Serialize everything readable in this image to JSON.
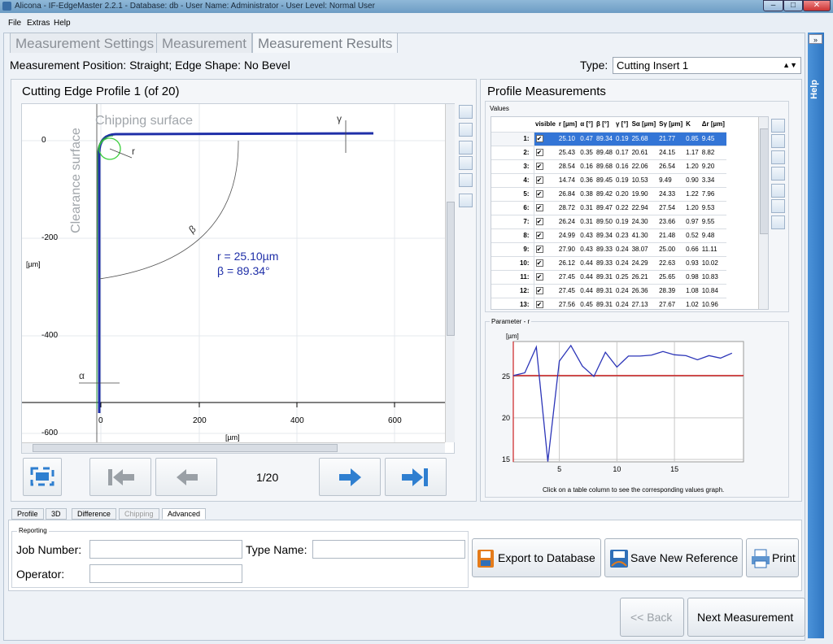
{
  "window": {
    "title": "Alicona - IF-EdgeMaster 2.2.1 - Database: db - User Name: Administrator - User Level: Normal User",
    "controls": [
      "–",
      "□",
      "✕"
    ]
  },
  "menu": [
    "File",
    "Extras",
    "Help"
  ],
  "tabs": [
    "Measurement Settings",
    "Measurement",
    "Measurement Results"
  ],
  "help_label": "Help",
  "help_chevron": "»",
  "position_text": "Measurement Position: Straight; Edge Shape: No Bevel",
  "type": {
    "label": "Type:",
    "value": "Cutting Insert 1"
  },
  "profile_panel": {
    "title": "Cutting Edge Profile 1 (of 20)",
    "chipping_surface": "Chipping surface",
    "clearance_surface": "Clearance surface",
    "result_r": "r = 25.10µm",
    "result_beta": "β = 89.34°",
    "label_beta": "β",
    "label_r": "r",
    "label_gamma": "γ",
    "label_alpha": "α",
    "y_unit": "[µm]",
    "x_unit": "[µm]",
    "y_ticks": [
      "0",
      "-200",
      "-400",
      "-600"
    ],
    "x_ticks": [
      "0",
      "200",
      "400",
      "600"
    ],
    "counter": "1/20"
  },
  "measurements_panel": {
    "title": "Profile Measurements",
    "values_label": "Values",
    "columns": [
      "",
      "visible",
      "r [µm]",
      "α [°]",
      "β [°]",
      "γ [°]",
      "Sα [µm]",
      "Sγ [µm]",
      "K",
      "Δr [µm]"
    ],
    "rows": [
      [
        "1:",
        "25.10",
        "0.47",
        "89.34",
        "0.19",
        "25.68",
        "21.77",
        "0.85",
        "9.45"
      ],
      [
        "2:",
        "25.43",
        "0.35",
        "89.48",
        "0.17",
        "20.61",
        "24.15",
        "1.17",
        "8.82"
      ],
      [
        "3:",
        "28.54",
        "0.16",
        "89.68",
        "0.16",
        "22.06",
        "26.54",
        "1.20",
        "9.20"
      ],
      [
        "4:",
        "14.74",
        "0.36",
        "89.45",
        "0.19",
        "10.53",
        "9.49",
        "0.90",
        "3.34"
      ],
      [
        "5:",
        "26.84",
        "0.38",
        "89.42",
        "0.20",
        "19.90",
        "24.33",
        "1.22",
        "7.96"
      ],
      [
        "6:",
        "28.72",
        "0.31",
        "89.47",
        "0.22",
        "22.94",
        "27.54",
        "1.20",
        "9.53"
      ],
      [
        "7:",
        "26.24",
        "0.31",
        "89.50",
        "0.19",
        "24.30",
        "23.66",
        "0.97",
        "9.55"
      ],
      [
        "8:",
        "24.99",
        "0.43",
        "89.34",
        "0.23",
        "41.30",
        "21.48",
        "0.52",
        "9.48"
      ],
      [
        "9:",
        "27.90",
        "0.43",
        "89.33",
        "0.24",
        "38.07",
        "25.00",
        "0.66",
        "11.11"
      ],
      [
        "10:",
        "26.12",
        "0.44",
        "89.33",
        "0.24",
        "24.29",
        "22.63",
        "0.93",
        "10.02"
      ],
      [
        "11:",
        "27.45",
        "0.44",
        "89.31",
        "0.25",
        "26.21",
        "25.65",
        "0.98",
        "10.83"
      ],
      [
        "12:",
        "27.45",
        "0.44",
        "89.31",
        "0.24",
        "26.36",
        "28.39",
        "1.08",
        "10.84"
      ],
      [
        "13:",
        "27.56",
        "0.45",
        "89.31",
        "0.24",
        "27.13",
        "27.67",
        "1.02",
        "10.96"
      ]
    ],
    "check_mark": "✔",
    "param_label": "Parameter - r",
    "graph_unit": "[µm]",
    "graph_hint": "Click on a table column to see the corresponding values graph."
  },
  "chart_data": {
    "type": "line",
    "title": "",
    "ylabel": "[µm]",
    "x": [
      1,
      2,
      3,
      4,
      5,
      6,
      7,
      8,
      9,
      10,
      11,
      12,
      13,
      14,
      15,
      16,
      17,
      18,
      19,
      20
    ],
    "series": [
      {
        "values": [
          25.1,
          25.43,
          28.54,
          14.74,
          26.84,
          28.72,
          26.24,
          24.99,
          27.9,
          26.12,
          27.45,
          27.45,
          27.56,
          28.0,
          27.6,
          27.5,
          27.0,
          27.5,
          27.2,
          27.8
        ]
      }
    ],
    "reference_line": 25.1,
    "xlim": [
      1,
      21
    ],
    "ylim": [
      14.7,
      29.2
    ],
    "x_ticks": [
      "5",
      "10",
      "15"
    ],
    "y_ticks": [
      "25",
      "20",
      "15"
    ],
    "grid": true,
    "colors": {
      "series": "#2c35b8",
      "reference": "#cc2222"
    }
  },
  "bottom_tabs": [
    "Profile",
    "3D",
    "Difference",
    "Chipping",
    "Advanced"
  ],
  "reporting": {
    "title": "Reporting",
    "job_number_label": "Job Number:",
    "job_number_value": "",
    "type_name_label": "Type Name:",
    "type_name_value": "",
    "operator_label": "Operator:",
    "operator_value": ""
  },
  "buttons": {
    "export": "Export to Database",
    "save_reference": "Save New Reference",
    "print": "Print",
    "back": "<< Back",
    "next": "Next Measurement"
  },
  "colors": {
    "accent": "#2f7fd0",
    "profile_blue": "#1f2fa8",
    "selection": "#3375d6"
  }
}
